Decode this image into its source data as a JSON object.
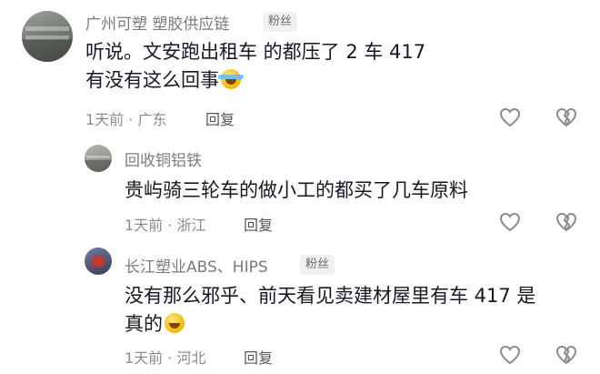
{
  "comments": [
    {
      "author": "广州可塑 塑胶供应链",
      "badge": "粉丝",
      "line1": "听说。文安跑出租车 的都压了 2 车 417",
      "line2": "有没有这么回事",
      "emoji_icon": "laughing-tears-emoji",
      "meta": "1天前 · 广东",
      "reply": "回复"
    },
    {
      "author": "回收铜铝铁",
      "line1": "贵屿骑三轮车的做小工的都买了几车原料",
      "meta": "1天前 · 浙江",
      "reply": "回复"
    },
    {
      "author": "长江塑业ABS、HIPS",
      "badge": "粉丝",
      "line1": "没有那么邪乎、前天看见卖建材屋里有车 417 是",
      "line2": "真的",
      "emoji_icon": "grinning-emoji",
      "meta": "1天前 · 河北",
      "reply": "回复"
    }
  ],
  "icons": {
    "like": "heart-outline-icon",
    "dislike": "broken-heart-icon"
  },
  "colors": {
    "text": "#161823",
    "secondary": "#8a8a90",
    "icon": "#8a8a90"
  }
}
